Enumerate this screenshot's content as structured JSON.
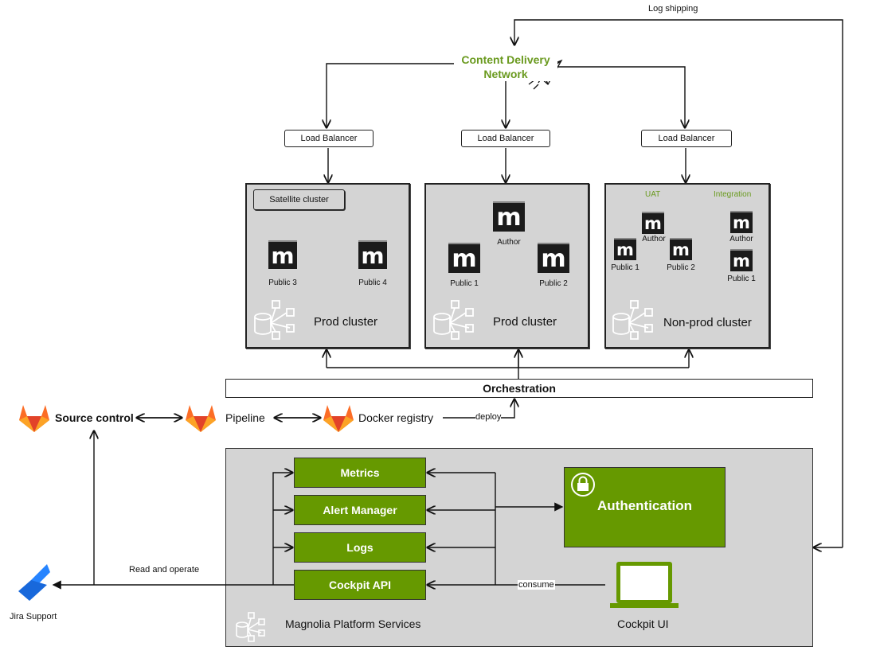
{
  "cdn": {
    "line1": "Content Delivery",
    "line2": "Network",
    "color": "#6a9a1f"
  },
  "log_shipping": "Log shipping",
  "load_balancers": [
    "Load Balancer",
    "Load Balancer",
    "Load Balancer"
  ],
  "clusters": [
    {
      "badge": "Satellite cluster",
      "label": "Prod cluster",
      "nodes": [
        "Public 3",
        "Public 4"
      ]
    },
    {
      "label": "Prod cluster",
      "nodes": [
        "Author",
        "Public 1",
        "Public 2"
      ]
    },
    {
      "label": "Non-prod cluster",
      "groups": [
        {
          "title": "UAT",
          "nodes": [
            "Author",
            "Public 1",
            "Public 2"
          ]
        },
        {
          "title": "Integration",
          "nodes": [
            "Author",
            "Public 1"
          ]
        }
      ]
    }
  ],
  "node_glyph": "m",
  "orchestration": "Orchestration",
  "toolchain": {
    "source": "Source control",
    "pipeline": "Pipeline",
    "registry": "Docker registry",
    "deploy": "deploy",
    "icon": "gitlab-icon"
  },
  "platform": {
    "title": "Magnolia Platform Services",
    "services": [
      "Metrics",
      "Alert Manager",
      "Logs",
      "Cockpit API"
    ],
    "auth": "Authentication",
    "consume": "consume",
    "ui": "Cockpit UI",
    "accent": "#669900"
  },
  "jira": {
    "label": "Jira Support",
    "link": "Read and operate"
  }
}
